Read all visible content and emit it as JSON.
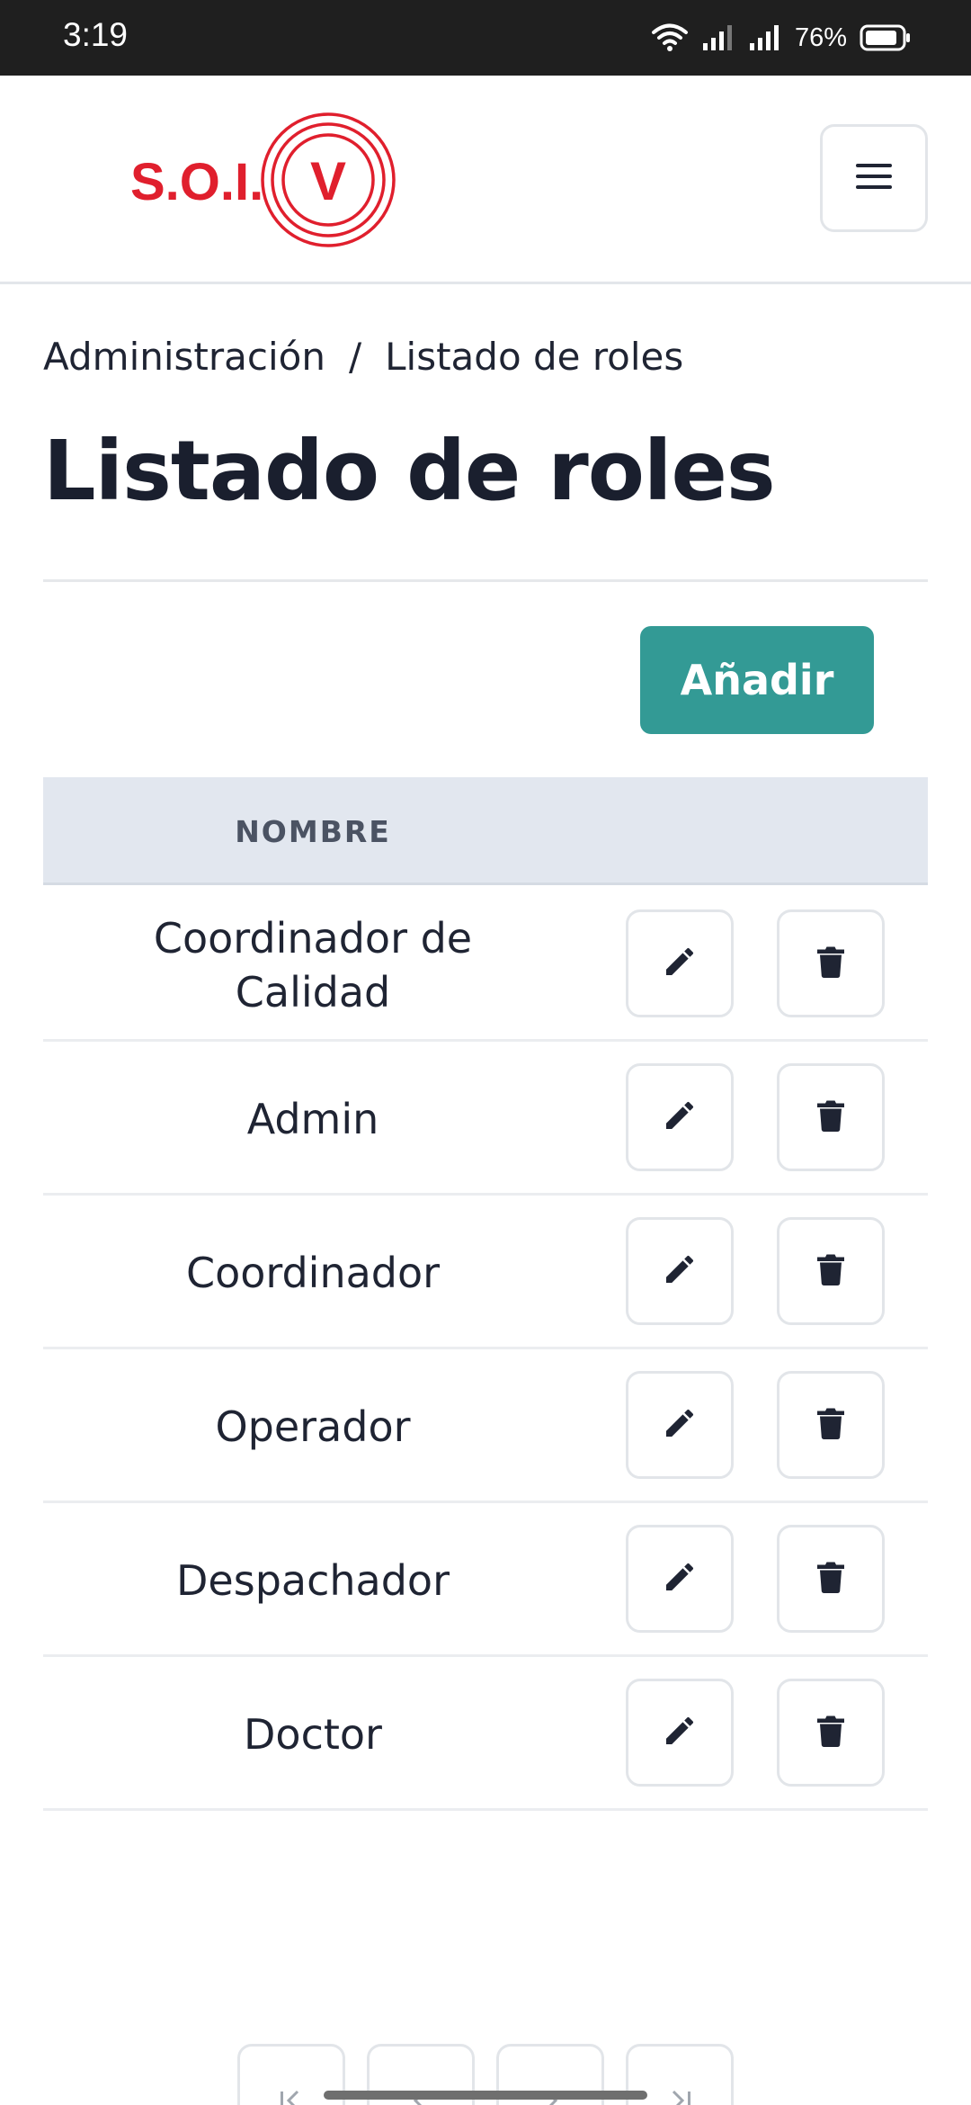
{
  "status_bar": {
    "time": "3:19",
    "battery_percent": "76%",
    "icons": [
      "wifi-icon",
      "signal-icon",
      "signal-icon",
      "battery-icon"
    ]
  },
  "header": {
    "logo_text": "S.O.I.",
    "logo_letter": "V",
    "brand_color": "#e01f2d",
    "menu_icon": "hamburger-icon"
  },
  "breadcrumb": {
    "items": [
      "Administración",
      "Listado de roles"
    ],
    "separator": "/"
  },
  "page": {
    "title": "Listado de roles",
    "add_button_label": "Añadir",
    "accent_color": "#339a95"
  },
  "table": {
    "columns": [
      "NOMBRE"
    ],
    "rows": [
      {
        "name": "Coordinador de Calidad"
      },
      {
        "name": "Admin"
      },
      {
        "name": "Coordinador"
      },
      {
        "name": "Operador"
      },
      {
        "name": "Despachador"
      },
      {
        "name": "Doctor"
      }
    ],
    "row_action_icons": [
      "pencil-icon",
      "trash-icon"
    ]
  },
  "pagination": {
    "icons": [
      "first-page-icon",
      "previous-page-icon",
      "next-page-icon",
      "last-page-icon"
    ]
  }
}
